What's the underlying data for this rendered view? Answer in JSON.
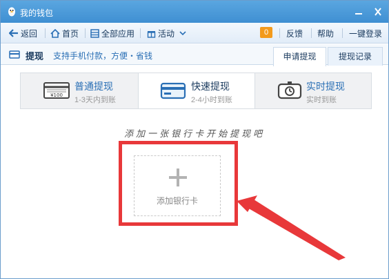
{
  "window": {
    "title": "我的钱包"
  },
  "toolbar": {
    "back": "返回",
    "home": "首页",
    "apps": "全部应用",
    "activity": "活动",
    "badge": "0",
    "feedback": "反馈",
    "help": "帮助",
    "login": "一键登录"
  },
  "section": {
    "title": "提现",
    "desc": "支持手机付款，方便・省钱",
    "tabs": [
      {
        "label": "申请提现",
        "active": true
      },
      {
        "label": "提现记录",
        "active": false
      }
    ]
  },
  "methods": [
    {
      "title": "普通提现",
      "subtitle": "1-3天内到账",
      "icon": "card-¥100-icon",
      "active": false
    },
    {
      "title": "快速提现",
      "subtitle": "2-4小时到账",
      "icon": "bank-card-icon",
      "active": true
    },
    {
      "title": "实时提现",
      "subtitle": "实时到账",
      "icon": "stopwatch-icon",
      "active": false
    }
  ],
  "card_icon_text": "¥100",
  "prompt": "添加一张银行卡开始提现吧",
  "add_card": {
    "label": "添加银行卡",
    "icon": "plus-icon"
  },
  "colors": {
    "highlight": "#e8383a",
    "accent": "#2a6fb5",
    "titlebar": "#4a9ad8"
  }
}
